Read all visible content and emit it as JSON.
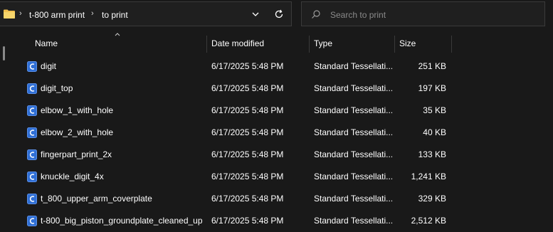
{
  "breadcrumb": {
    "items": [
      "t-800 arm print",
      "to print"
    ]
  },
  "search": {
    "placeholder": "Search to print",
    "value": ""
  },
  "columns": {
    "name": "Name",
    "date": "Date modified",
    "type": "Type",
    "size": "Size"
  },
  "files": [
    {
      "name": "digit",
      "date": "6/17/2025 5:48 PM",
      "type": "Standard Tessellati...",
      "size": "251 KB"
    },
    {
      "name": "digit_top",
      "date": "6/17/2025 5:48 PM",
      "type": "Standard Tessellati...",
      "size": "197 KB"
    },
    {
      "name": "elbow_1_with_hole",
      "date": "6/17/2025 5:48 PM",
      "type": "Standard Tessellati...",
      "size": "35 KB"
    },
    {
      "name": "elbow_2_with_hole",
      "date": "6/17/2025 5:48 PM",
      "type": "Standard Tessellati...",
      "size": "40 KB"
    },
    {
      "name": "fingerpart_print_2x",
      "date": "6/17/2025 5:48 PM",
      "type": "Standard Tessellati...",
      "size": "133 KB"
    },
    {
      "name": "knuckle_digit_4x",
      "date": "6/17/2025 5:48 PM",
      "type": "Standard Tessellati...",
      "size": "1,241 KB"
    },
    {
      "name": "t_800_upper_arm_coverplate",
      "date": "6/17/2025 5:48 PM",
      "type": "Standard Tessellati...",
      "size": "329 KB"
    },
    {
      "name": "t-800_big_piston_groundplate_cleaned_up",
      "date": "6/17/2025 5:48 PM",
      "type": "Standard Tessellati...",
      "size": "2,512 KB"
    }
  ],
  "icons": {
    "folder": "folder-icon",
    "file": "stl-file-icon",
    "search": "search-icon",
    "refresh": "refresh-icon",
    "dropdown": "chevron-down-icon"
  },
  "colors": {
    "background": "#191919",
    "file_icon": "#2f6fd6",
    "folder": "#f2c14e"
  }
}
